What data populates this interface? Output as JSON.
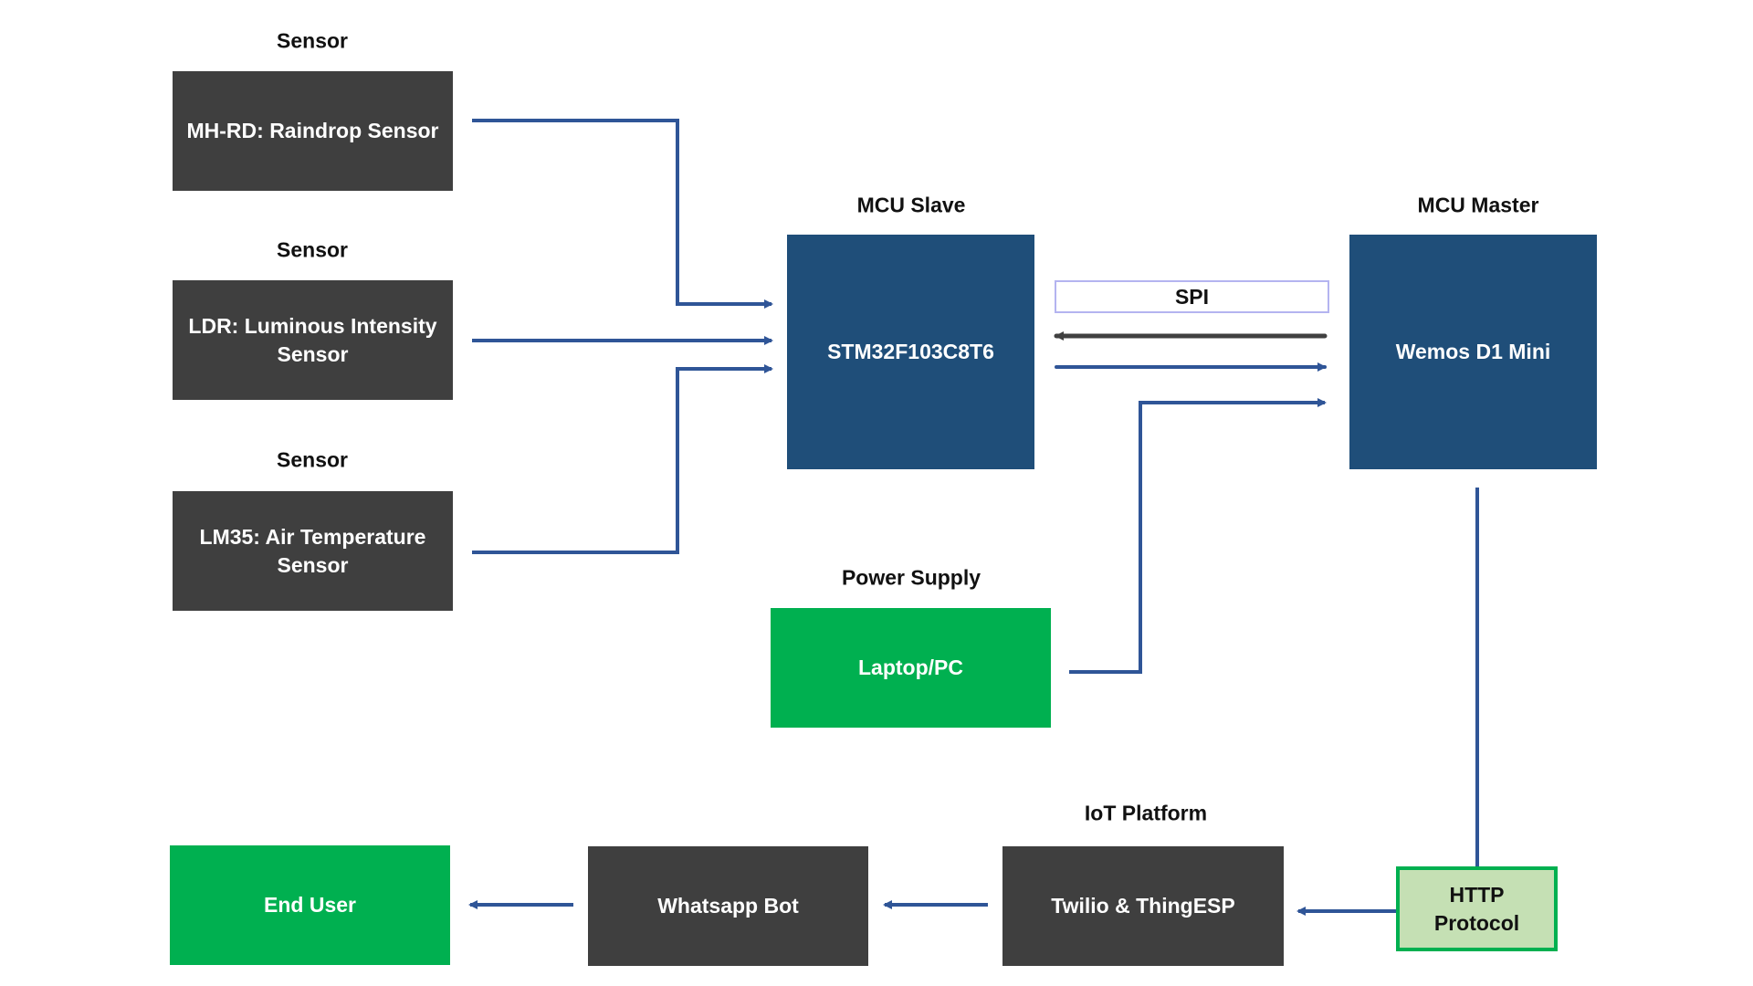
{
  "colors": {
    "dark_box": "#3f3f3f",
    "mcu_box": "#1f4e79",
    "green_box": "#00b050",
    "http_box": "#c5e0b4",
    "connector": "#2f5597",
    "spi_return": "#404040"
  },
  "sensors": [
    {
      "label": "Sensor",
      "name": "MH-RD: Raindrop Sensor"
    },
    {
      "label": "Sensor",
      "name": "LDR: Luminous Intensity Sensor"
    },
    {
      "label": "Sensor",
      "name": "LM35: Air Temperature Sensor"
    }
  ],
  "mcu_slave": {
    "label": "MCU Slave",
    "name": "STM32F103C8T6"
  },
  "mcu_master": {
    "label": "MCU Master",
    "name": "Wemos D1 Mini"
  },
  "spi": {
    "label": "SPI"
  },
  "power": {
    "label": "Power Supply",
    "name": "Laptop/PC"
  },
  "http": {
    "name": "HTTP Protocol"
  },
  "iot": {
    "label": "IoT Platform",
    "name": "Twilio & ThingESP"
  },
  "whatsapp": {
    "name": "Whatsapp Bot"
  },
  "end_user": {
    "name": "End User"
  }
}
